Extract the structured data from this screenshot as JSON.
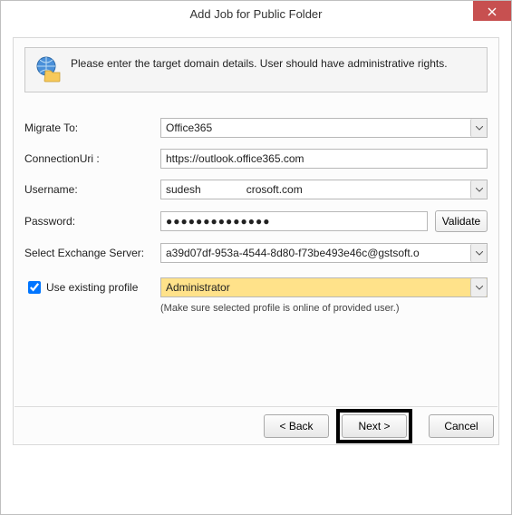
{
  "window": {
    "title": "Add Job for Public Folder"
  },
  "info": {
    "text": "Please enter the target domain details. User should have administrative rights."
  },
  "form": {
    "migrate_to_label": "Migrate To:",
    "migrate_to_value": "Office365",
    "connection_uri_label": "ConnectionUri :",
    "connection_uri_value": "https://outlook.office365.com",
    "username_label": "Username:",
    "username_value": "sudesh               crosoft.com",
    "password_label": "Password:",
    "password_mask": "●●●●●●●●●●●●●●",
    "validate_label": "Validate",
    "server_label": "Select Exchange Server:",
    "server_value": "a39d07df-953a-4544-8d80-f73be493e46c@gstsoft.o",
    "use_profile_label": "Use existing profile",
    "profile_value": "Administrator",
    "profile_hint": "(Make sure selected profile is online of provided user.)"
  },
  "buttons": {
    "back": "< Back",
    "next": "Next >",
    "cancel": "Cancel"
  }
}
